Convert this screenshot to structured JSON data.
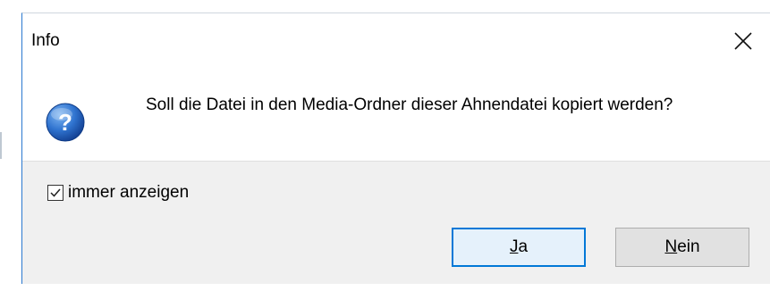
{
  "dialog": {
    "title": "Info",
    "close_glyph": "✕",
    "icon": "question-icon",
    "message": "Soll die Datei in den Media-Ordner dieser Ahnendatei kopiert werden?",
    "checkbox": {
      "label": "immer anzeigen",
      "checked": true
    },
    "buttons": {
      "yes": {
        "mnemonic": "J",
        "rest": "a"
      },
      "no": {
        "mnemonic": "N",
        "rest": "ein"
      }
    }
  },
  "colors": {
    "accent": "#0078d7",
    "footer_bg": "#f0f0f0",
    "icon_blue": "#1a5fb4"
  }
}
